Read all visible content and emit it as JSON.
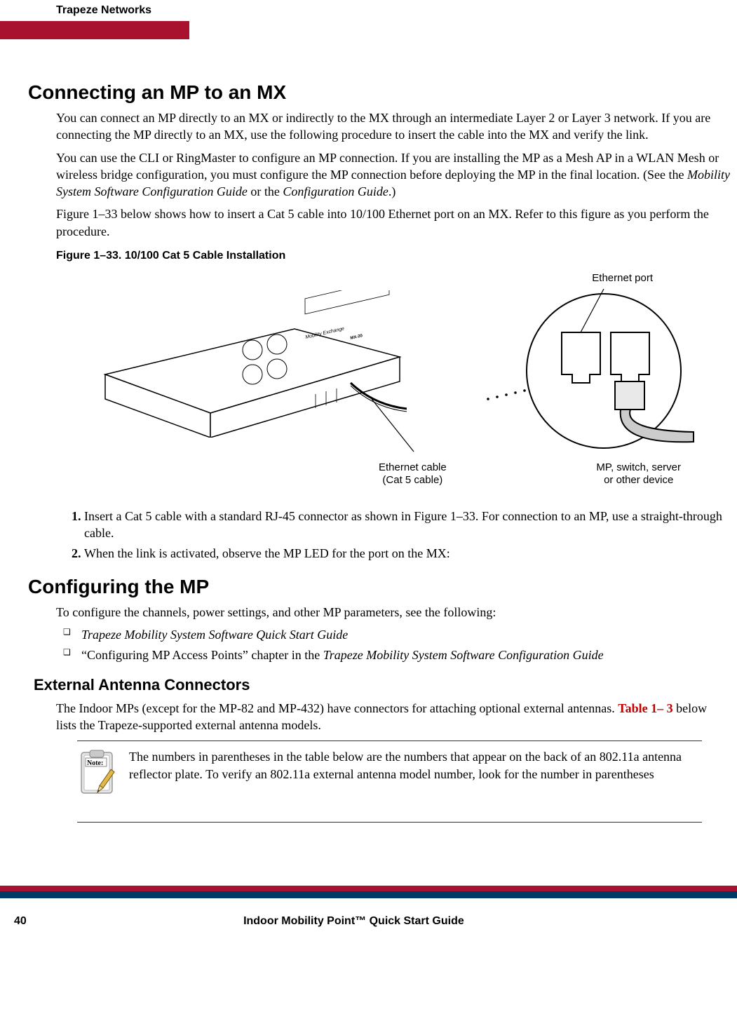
{
  "header": {
    "company": "Trapeze Networks"
  },
  "section1": {
    "title": "Connecting an MP to an MX",
    "para1": "You can connect an MP directly to an MX or indirectly to the MX through an intermediate Layer 2 or Layer 3 network. If you are connecting the MP directly to an MX, use the following procedure to insert the cable into the MX and verify the link.",
    "para2a": "You can use the CLI or RingMaster to configure an MP connection. If you are installing the MP as a Mesh AP in a WLAN Mesh or wireless bridge configuration, you must configure the MP connection before deploying the MP in the final location. (See the ",
    "para2_em1": "Mobility System Software Configuration Guide",
    "para2b": " or the ",
    "para2_em2": "Configuration Guide",
    "para2c": ".)",
    "para3": "Figure 1–33 below shows how to insert a Cat 5 cable into 10/100 Ethernet port on an MX. Refer to this figure as you perform the procedure.",
    "fig_caption": "Figure 1–33.  10/100 Cat 5 Cable Installation",
    "lbl_eth_port": "Ethernet port",
    "lbl_eth_cable1": "Ethernet cable",
    "lbl_eth_cable2": "(Cat 5 cable)",
    "lbl_device1": "MP, switch, server",
    "lbl_device2": "or other device",
    "step1": "Insert a Cat 5 cable with a standard RJ-45 connector as shown in Figure 1–33. For connection to an MP, use a straight-through cable.",
    "step2": "When the link is activated, observe the MP LED for the port on the MX:"
  },
  "section2": {
    "title": "Configuring the MP",
    "para1": "To configure the channels, power settings, and other MP parameters, see the following:",
    "ref1": "Trapeze Mobility System Software Quick Start Guide",
    "ref2a": "“Configuring MP Access Points” chapter in the ",
    "ref2em": "Trapeze Mobility System Software Configuration Guide",
    "sub_title": "External Antenna Connectors",
    "para2a": "The Indoor MPs (except for the MP-82 and MP-432) have connectors for attaching optional external antennas. ",
    "para2link": "Table 1– 3",
    "para2b": " below lists the Trapeze-supported external antenna models.",
    "note": "The numbers in parentheses in the table below are the numbers that appear on the back of an 802.11a antenna reflector plate. To verify an 802.11a external antenna model number, look for the number in parentheses"
  },
  "footer": {
    "page": "40",
    "doc_title": "Indoor Mobility Point™ Quick Start Guide"
  }
}
